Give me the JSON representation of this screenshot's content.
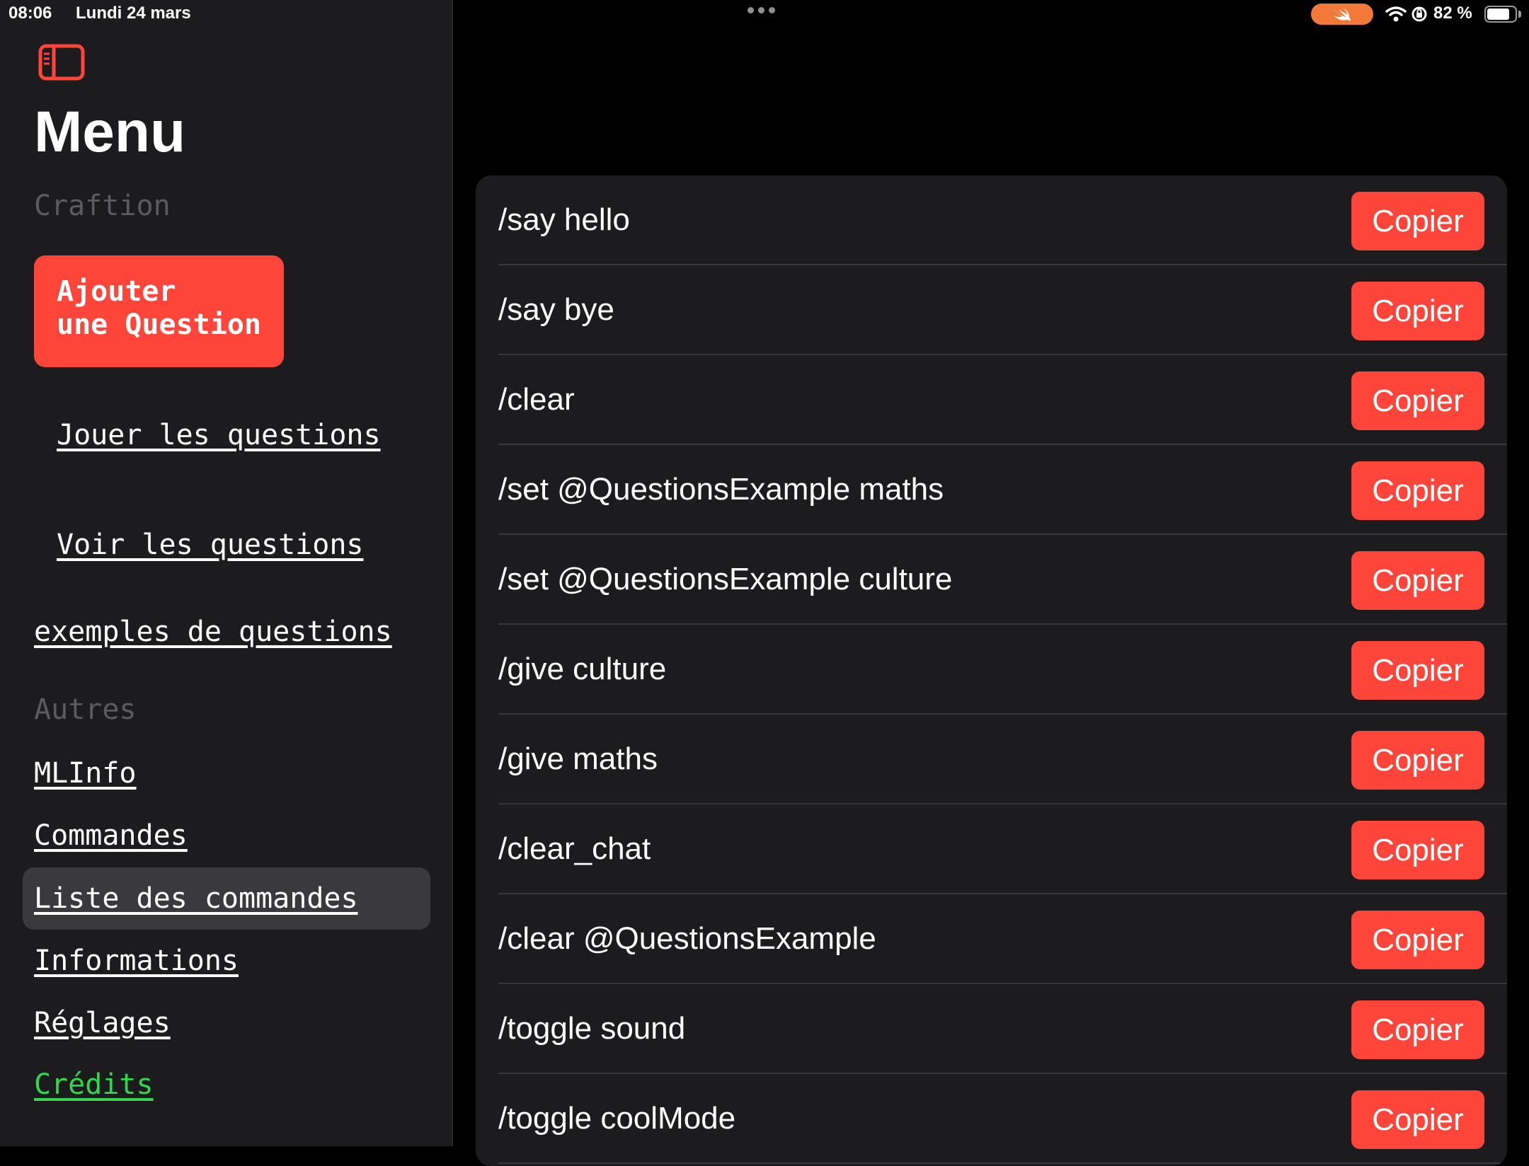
{
  "status_bar": {
    "time": "08:06",
    "date": "Lundi 24 mars",
    "battery_percent": "82 %",
    "battery_level": 0.82
  },
  "sidebar": {
    "title": "Menu",
    "sections": [
      {
        "header": "Craftion"
      },
      {
        "header": "Autres"
      }
    ],
    "add_button": {
      "line1": "Ajouter",
      "line2": "une Question"
    },
    "links": [
      {
        "label": "Jouer les questions"
      },
      {
        "label": "Voir les questions"
      },
      {
        "label": "exemples de questions"
      },
      {
        "label": "MLInfo"
      },
      {
        "label": "Commandes"
      },
      {
        "label": "Liste des commandes",
        "selected": true
      },
      {
        "label": "Informations"
      },
      {
        "label": "Réglages"
      },
      {
        "label": "Crédits"
      }
    ]
  },
  "commands": {
    "copy_label": "Copier",
    "items": [
      "/say hello",
      "/say bye",
      "/clear",
      "/set @QuestionsExample maths",
      "/set @QuestionsExample culture",
      "/give culture",
      "/give maths",
      "/clear_chat",
      "/clear @QuestionsExample",
      "/toggle sound",
      "/toggle coolMode"
    ]
  },
  "colors": {
    "accent": "#ff453a",
    "sidebar_bg": "#1c1c1e",
    "selected_bg": "#3a3a3c",
    "credits_green": "#32d74b",
    "section_header": "#5b5b60"
  },
  "icons": [
    "sidebar-toggle-icon",
    "swift-icon",
    "wifi-icon",
    "orientation-lock-icon",
    "battery-icon"
  ]
}
